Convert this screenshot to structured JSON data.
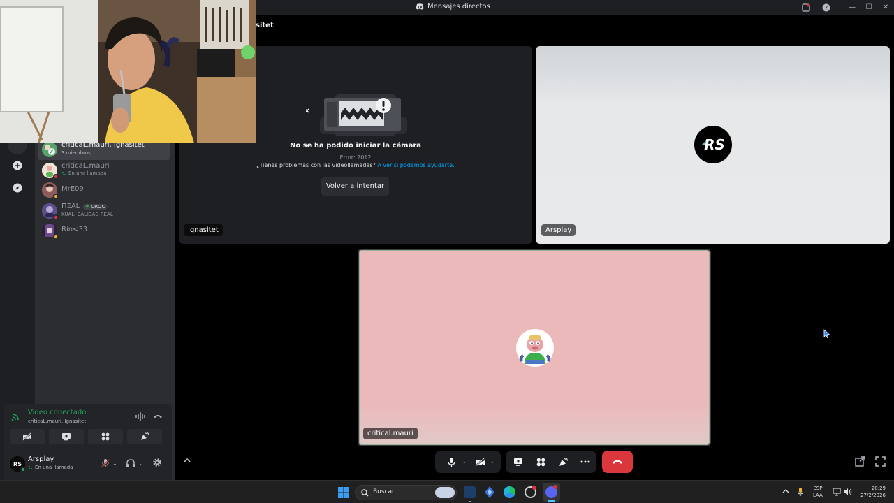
{
  "window": {
    "title": "Mensajes directos"
  },
  "header": {
    "channel_partial": "sitet"
  },
  "dm_list": [
    {
      "name": "criticaL.mauri, Ignasitet",
      "sub": "3 miembros",
      "active": true
    },
    {
      "name": "criticaL.mauri",
      "sub": "En una llamada",
      "active": false
    },
    {
      "name": "MrE09",
      "sub": "",
      "active": false
    },
    {
      "name": "ΠΞΑL",
      "badge": "CROC",
      "sub": "KUALI CALIDAD REAL",
      "active": false
    },
    {
      "name": "Rin<33",
      "sub": "",
      "active": false
    }
  ],
  "voice": {
    "status": "Video conectado",
    "channel": "criticaL.mauri, Ignasitet"
  },
  "user": {
    "name": "Arsplay",
    "status": "En una llamada"
  },
  "tiles": {
    "ignasitet": {
      "error_title": "No se ha podido iniciar la cámara",
      "error_code": "Error: 2012",
      "help_text": "¿Tienes problemas con las videollamadas?",
      "help_link": "A ver si podemos ayudarte.",
      "retry_label": "Volver a intentar",
      "name": "Ignasitet"
    },
    "arsplay": {
      "name": "Arsplay",
      "logo_text": "RS"
    },
    "critical": {
      "name": "critical.mauri"
    }
  },
  "taskbar": {
    "search_placeholder": "Buscar",
    "lang_top": "ESP",
    "lang_bottom": "LAA",
    "time": "20:29",
    "date": "27/2/2026"
  },
  "colors": {
    "accent_green": "#23a55a",
    "danger_red": "#da373c",
    "link_blue": "#00a8fc",
    "tile_gray": "#e3e5e8",
    "tile_pink": "#ebb9b9"
  }
}
